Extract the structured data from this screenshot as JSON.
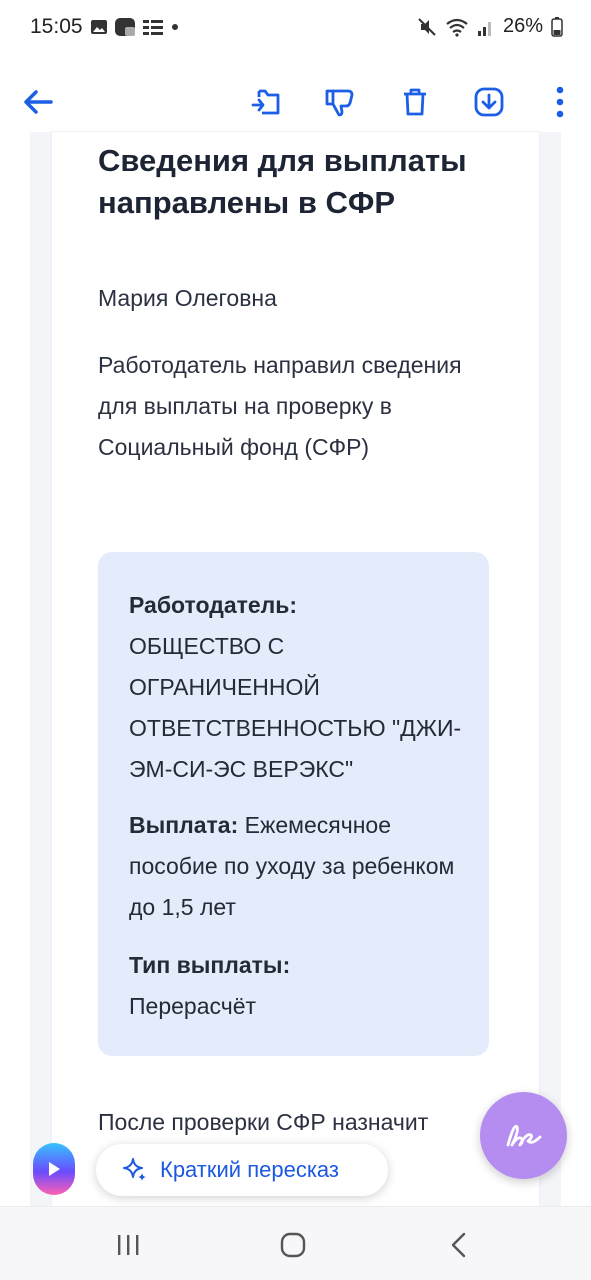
{
  "status_bar": {
    "time": "15:05",
    "battery": "26%",
    "icons_left": [
      "gallery-icon",
      "app-icon",
      "mail-grid-icon",
      "dot-icon"
    ],
    "icons_right": [
      "mute-icon",
      "wifi-icon",
      "signal-icon",
      "battery-icon"
    ]
  },
  "toolbar": {
    "icons": [
      "back-arrow-icon",
      "move-to-folder-icon",
      "thumbs-down-icon",
      "trash-icon",
      "download-icon",
      "more-vertical-icon"
    ],
    "accent": "#1c5fe6"
  },
  "message": {
    "title": "Сведения для выплаты направлены в СФР",
    "greeting": "Мария Олеговна",
    "intro": "Работодатель направил сведения для выплаты на проверку в Социальный фонд (СФР)",
    "info": {
      "employer_label": "Работодатель:",
      "employer_value": "ОБЩЕСТВО С ОГРАНИЧЕННОЙ ОТВЕТСТВЕННОСТЬЮ \"ДЖИ-ЭМ-СИ-ЭС ВЕРЭКС\"",
      "payment_label": "Выплата:",
      "payment_value": "Ежемесячное пособие по уходу за ребенком до 1,5 лет",
      "type_label": "Тип выплаты:",
      "type_value": "Перерасчёт"
    },
    "after_text": "После проверки СФР назначит"
  },
  "floating": {
    "summary_label": "Краткий пересказ",
    "fab_icon": "compose-signature-icon"
  },
  "navbar": {
    "icons": [
      "recent-apps-icon",
      "home-icon",
      "back-icon"
    ]
  }
}
